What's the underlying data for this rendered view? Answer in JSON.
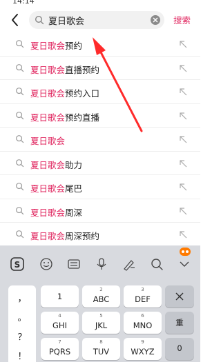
{
  "status": {
    "time": "14:14"
  },
  "search": {
    "back_icon": "chevron-left-icon",
    "query": "夏日歌会",
    "clear_icon": "clear-circle-icon",
    "search_label": "搜索"
  },
  "accent_color": "#e0245e",
  "suggestions": [
    {
      "highlight": "夏日歌会",
      "rest": "预约"
    },
    {
      "highlight": "夏日歌会",
      "rest": "直播预约"
    },
    {
      "highlight": "夏日歌会",
      "rest": "预约入口"
    },
    {
      "highlight": "夏日歌会",
      "rest": "预约直播"
    },
    {
      "highlight": "夏日歌会",
      "rest": ""
    },
    {
      "highlight": "夏日歌会",
      "rest": "助力"
    },
    {
      "highlight": "夏日歌会",
      "rest": "尾巴"
    },
    {
      "highlight": "夏日歌会",
      "rest": "周深"
    },
    {
      "highlight": "夏日歌会",
      "rest": "周深预约"
    }
  ],
  "keyboard": {
    "toolbar_icons": [
      "sogou-logo-icon",
      "emoji-icon",
      "keyboard-icon",
      "microphone-icon",
      "handwriting-icon",
      "search-icon",
      "collapse-icon"
    ],
    "punctuation": [
      "，",
      "。",
      "？",
      "！"
    ],
    "keys": [
      {
        "num": "",
        "main": "1"
      },
      {
        "num": "2",
        "main": "ABC"
      },
      {
        "num": "3",
        "main": "DEF"
      },
      {
        "num": "4",
        "main": "GHI"
      },
      {
        "num": "5",
        "main": "JKL"
      },
      {
        "num": "6",
        "main": "MNO"
      },
      {
        "num": "7",
        "main": "PQRS"
      },
      {
        "num": "8",
        "main": "TUV"
      },
      {
        "num": "9",
        "main": "WXYZ"
      }
    ],
    "reenter_label": "重",
    "zero_label": "0"
  }
}
